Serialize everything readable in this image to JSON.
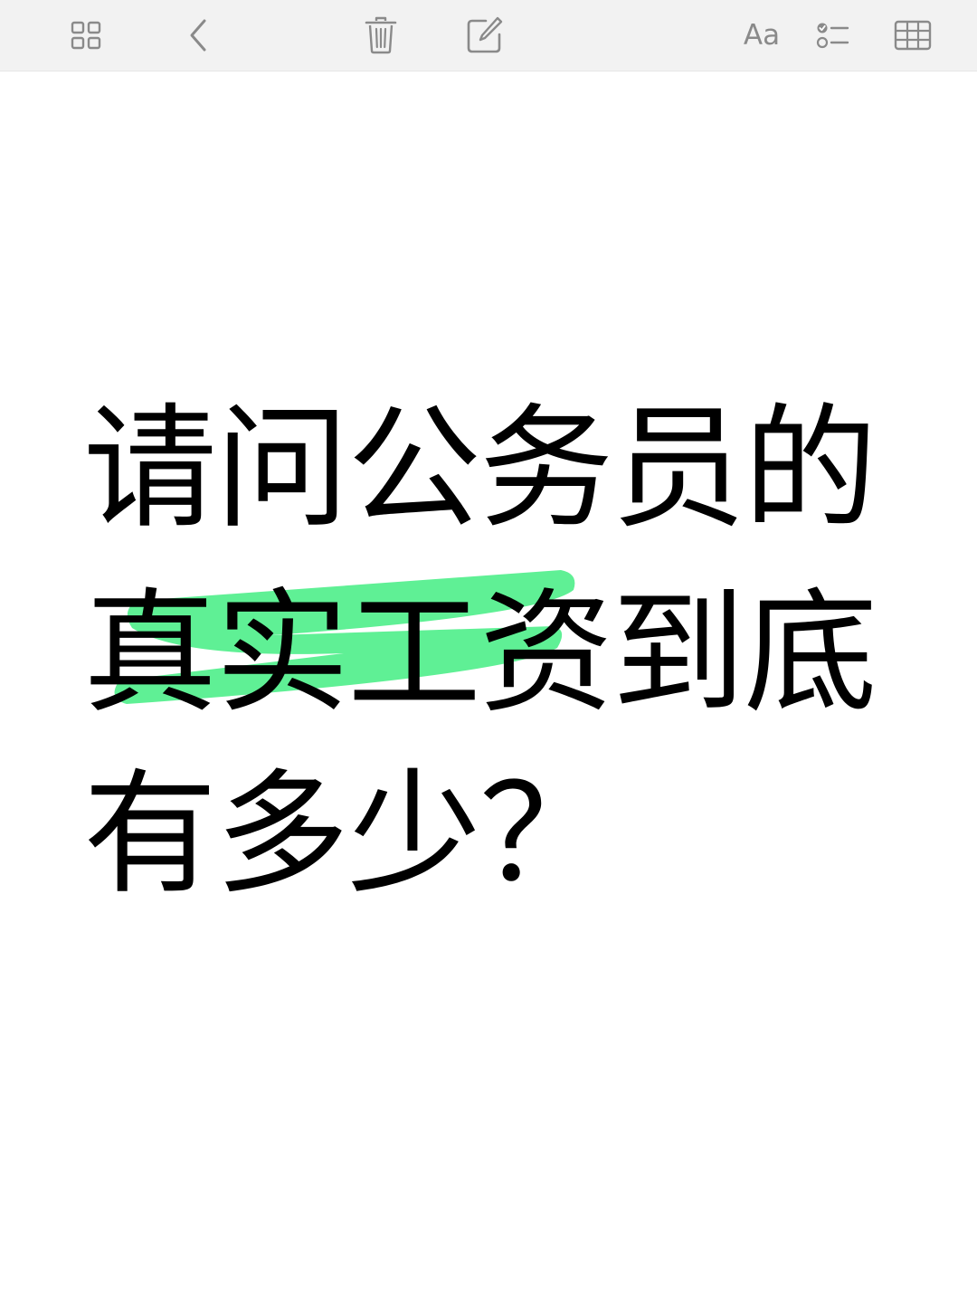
{
  "toolbar": {
    "buttons": [
      {
        "name": "gallery-view-icon",
        "interactable": true
      },
      {
        "name": "back-chevron-icon",
        "interactable": true
      },
      {
        "name": "trash-icon",
        "interactable": true
      },
      {
        "name": "compose-icon",
        "interactable": true
      },
      {
        "name": "text-format-button",
        "label": "Aa",
        "interactable": true
      },
      {
        "name": "checklist-icon",
        "interactable": true
      },
      {
        "name": "table-icon",
        "interactable": true
      }
    ],
    "text_format_label": "Aa",
    "icon_color": "#8a8a8a",
    "background_color": "#f2f2f2"
  },
  "note": {
    "lines": [
      "请问公务员的",
      "真实工资到底",
      "有多少？"
    ],
    "highlighted_text": "真实工资",
    "highlight_color": "#5ff095",
    "text_color": "#000000"
  }
}
